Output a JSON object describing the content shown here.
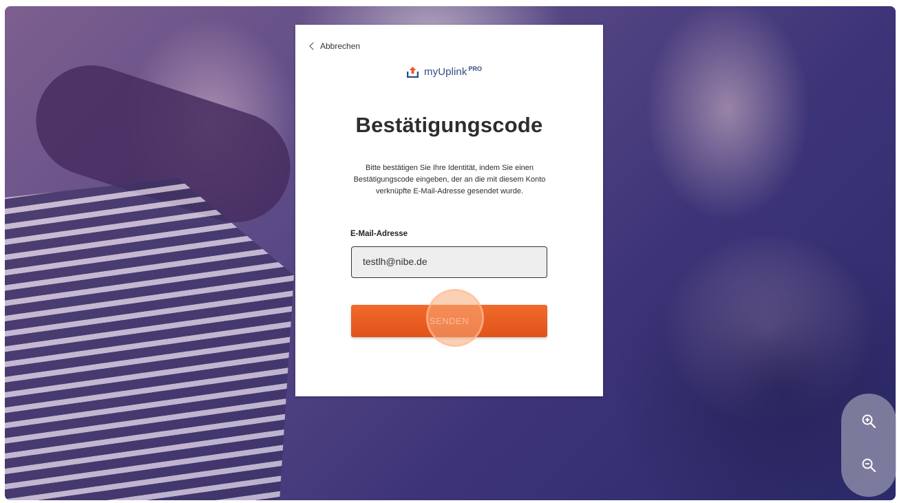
{
  "back": {
    "label": "Abbrechen"
  },
  "brand": {
    "name": "myUplink",
    "suffix": "PRO",
    "color": "#2f4d86",
    "icon": "upload-logo-icon"
  },
  "page": {
    "title": "Bestätigungscode",
    "description": "Bitte bestätigen Sie Ihre Identität, indem Sie einen Bestätigungscode eingeben, der an die mit diesem Konto verknüpfte E-Mail-Adresse gesendet wurde."
  },
  "form": {
    "email_label": "E-Mail-Adresse",
    "email_value": "testlh@nibe.de",
    "submit_label": "SENDEN"
  },
  "colors": {
    "accent": "#e8592a"
  },
  "zoom": {
    "in_icon": "zoom-in-icon",
    "out_icon": "zoom-out-icon"
  }
}
